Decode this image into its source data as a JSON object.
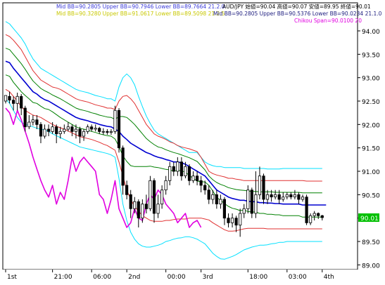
{
  "chart_data": {
    "type": "line",
    "title": "",
    "instrument_label": "AUD/JPY 始値=90.04 高値=90.07 安値=89.95 終値=90.01",
    "indicator_labels": [
      {
        "text": "Mid BB=90.2805 Upper BB=90.7946 Lower BB=89.7664  21.2.0",
        "color": "#3a3ad8"
      },
      {
        "text": "Mid BB=90.3280 Upper BB=91.0617 Lower BB=89.5098  21.2.5",
        "color": "#c8c800"
      },
      {
        "text": "Mid BB=90.2805 Upper BB=90.5376 Lower BB=90.0234  21.1.0",
        "color": "#202080"
      },
      {
        "text": "Chikou Span=90.0100  20",
        "color": "#e000e0"
      }
    ],
    "ylim": [
      88.9,
      94.6
    ],
    "y_ticks": [
      "94.00",
      "93.50",
      "93.00",
      "92.50",
      "92.00",
      "91.50",
      "91.00",
      "90.50",
      "90.00",
      "89.50",
      "89.00"
    ],
    "y_tick_values": [
      94.0,
      93.5,
      93.0,
      92.5,
      92.0,
      91.5,
      91.0,
      90.5,
      90.0,
      89.5,
      89.0
    ],
    "x_ticks": [
      "1st",
      "21:00",
      "06:00",
      "2nd",
      "00:00",
      "3rd",
      "18:00",
      "03:00",
      "4th"
    ],
    "x_tick_positions": [
      0,
      12,
      22,
      31,
      41,
      50,
      62,
      72,
      81
    ],
    "n_bars": 86,
    "last_price_label": "90.01",
    "colors": {
      "mid_bb": "#0000d0",
      "bb_2_0": "#e03030",
      "bb_2_5": "#00e0ff",
      "bb_1_0": "#008000",
      "chikou": "#e000e0",
      "price_box": "#00c000",
      "candle_up": "#ffffff",
      "candle_down": "#000000"
    },
    "series": [
      {
        "key": "mid",
        "values": [
          93.35,
          93.32,
          93.2,
          93.1,
          93.0,
          92.9,
          92.8,
          92.7,
          92.65,
          92.58,
          92.53,
          92.5,
          92.45,
          92.4,
          92.35,
          92.3,
          92.25,
          92.2,
          92.15,
          92.12,
          92.1,
          92.08,
          92.05,
          92.03,
          92.0,
          91.98,
          91.96,
          91.95,
          91.9,
          91.85,
          91.75,
          91.68,
          91.6,
          91.55,
          91.5,
          91.45,
          91.4,
          91.37,
          91.33,
          91.3,
          91.28,
          91.25,
          91.23,
          91.2,
          91.2,
          91.18,
          91.15,
          91.1,
          91.05,
          91.0,
          90.95,
          90.9,
          90.8,
          90.7,
          90.6,
          90.55,
          90.5,
          90.45,
          90.42,
          90.4,
          90.38,
          90.38,
          90.36,
          90.35,
          90.35,
          90.33,
          90.33,
          90.32,
          90.32,
          90.31,
          90.31,
          90.3,
          90.3,
          90.3,
          90.3,
          90.3,
          90.28,
          90.28,
          90.28,
          90.28,
          90.28,
          90.28,
          90.28
        ]
      },
      {
        "key": "upper20",
        "values": [
          93.92,
          93.88,
          93.8,
          93.7,
          93.6,
          93.45,
          93.3,
          93.15,
          93.05,
          92.95,
          92.9,
          92.85,
          92.8,
          92.78,
          92.75,
          92.7,
          92.65,
          92.6,
          92.55,
          92.52,
          92.5,
          92.48,
          92.45,
          92.42,
          92.4,
          92.38,
          92.35,
          92.35,
          92.32,
          92.5,
          92.6,
          92.62,
          92.55,
          92.45,
          92.3,
          92.15,
          92.0,
          91.9,
          91.8,
          91.75,
          91.72,
          91.68,
          91.63,
          91.6,
          91.55,
          91.52,
          91.5,
          91.48,
          91.45,
          91.42,
          91.3,
          91.15,
          91.0,
          90.95,
          90.92,
          90.9,
          90.88,
          90.85,
          90.85,
          90.83,
          90.82,
          90.8,
          90.8,
          90.8,
          90.8,
          90.8,
          90.8,
          90.8,
          90.8,
          90.8,
          90.8,
          90.8,
          90.8,
          90.8,
          90.8,
          90.8,
          90.8,
          90.79,
          90.79,
          90.79,
          90.79,
          90.79
        ]
      },
      {
        "key": "lower20",
        "values": [
          92.75,
          92.7,
          92.6,
          92.5,
          92.38,
          92.3,
          92.25,
          92.2,
          92.18,
          92.15,
          92.1,
          92.05,
          92.0,
          91.96,
          91.93,
          91.9,
          91.86,
          91.82,
          91.78,
          91.74,
          91.72,
          91.7,
          91.68,
          91.65,
          91.62,
          91.58,
          91.55,
          91.5,
          91.45,
          91.2,
          90.9,
          90.6,
          90.4,
          90.25,
          90.15,
          90.05,
          90.0,
          89.95,
          89.93,
          89.93,
          89.93,
          89.95,
          89.95,
          89.97,
          89.98,
          89.98,
          89.98,
          90.0,
          90.0,
          90.0,
          90.0,
          89.98,
          89.96,
          89.9,
          89.85,
          89.8,
          89.75,
          89.72,
          89.72,
          89.73,
          89.75,
          89.77,
          89.78,
          89.78,
          89.78,
          89.78,
          89.78,
          89.77,
          89.77,
          89.77,
          89.77,
          89.77,
          89.77,
          89.77,
          89.77,
          89.77,
          89.77,
          89.77,
          89.77,
          89.77,
          89.77,
          89.77
        ]
      },
      {
        "key": "upper25",
        "values": [
          94.2,
          94.15,
          94.05,
          93.95,
          93.85,
          93.72,
          93.55,
          93.4,
          93.3,
          93.2,
          93.15,
          93.1,
          93.05,
          93.0,
          92.95,
          92.9,
          92.85,
          92.8,
          92.75,
          92.72,
          92.7,
          92.68,
          92.65,
          92.62,
          92.6,
          92.58,
          92.55,
          92.55,
          92.5,
          92.8,
          93.0,
          93.08,
          93.0,
          92.85,
          92.6,
          92.38,
          92.18,
          92.02,
          91.88,
          91.8,
          91.75,
          91.7,
          91.65,
          91.6,
          91.55,
          91.5,
          91.45,
          91.4,
          91.4,
          91.4,
          91.3,
          91.2,
          91.15,
          91.12,
          91.1,
          91.1,
          91.08,
          91.08,
          91.08,
          91.08,
          91.08,
          91.06,
          91.06,
          91.06,
          91.06,
          91.06,
          91.06,
          91.05,
          91.05,
          91.05,
          91.05,
          91.06,
          91.06,
          91.06,
          91.06,
          91.06,
          91.06,
          91.06,
          91.06,
          91.06,
          91.06,
          91.06
        ]
      },
      {
        "key": "lower25",
        "values": [
          92.55,
          92.45,
          92.3,
          92.15,
          92.05,
          92.0,
          91.98,
          91.95,
          91.92,
          91.9,
          91.88,
          91.85,
          91.8,
          91.76,
          91.72,
          91.68,
          91.64,
          91.6,
          91.56,
          91.52,
          91.5,
          91.48,
          91.46,
          91.44,
          91.42,
          91.4,
          91.38,
          91.35,
          91.3,
          90.85,
          90.3,
          89.95,
          89.7,
          89.55,
          89.45,
          89.4,
          89.38,
          89.38,
          89.4,
          89.42,
          89.45,
          89.5,
          89.52,
          89.55,
          89.57,
          89.58,
          89.6,
          89.6,
          89.58,
          89.55,
          89.5,
          89.45,
          89.35,
          89.25,
          89.18,
          89.13,
          89.12,
          89.15,
          89.18,
          89.22,
          89.27,
          89.32,
          89.35,
          89.38,
          89.4,
          89.42,
          89.42,
          89.43,
          89.45,
          89.46,
          89.48,
          89.48,
          89.5,
          89.5,
          89.5,
          89.5,
          89.5,
          89.5,
          89.5,
          89.5,
          89.5,
          89.5
        ]
      },
      {
        "key": "upper10",
        "values": [
          93.63,
          93.6,
          93.5,
          93.4,
          93.3,
          93.18,
          93.05,
          92.93,
          92.85,
          92.77,
          92.72,
          92.68,
          92.63,
          92.59,
          92.55,
          92.5,
          92.45,
          92.4,
          92.35,
          92.32,
          92.3,
          92.28,
          92.25,
          92.23,
          92.2,
          92.18,
          92.16,
          92.15,
          92.11,
          92.17,
          92.17,
          92.15,
          92.08,
          92.0,
          91.9,
          91.8,
          91.7,
          91.63,
          91.57,
          91.52,
          91.5,
          91.46,
          91.43,
          91.4,
          91.38,
          91.35,
          91.32,
          91.29,
          91.25,
          91.21,
          91.12,
          91.03,
          90.9,
          90.82,
          90.76,
          90.72,
          90.69,
          90.65,
          90.63,
          90.61,
          90.6,
          90.59,
          90.58,
          90.57,
          90.57,
          90.56,
          90.56,
          90.56,
          90.56,
          90.55,
          90.55,
          90.55,
          90.55,
          90.55,
          90.55,
          90.55,
          90.54,
          90.54,
          90.54,
          90.54,
          90.54,
          90.54
        ]
      },
      {
        "key": "lower10",
        "values": [
          93.06,
          93.03,
          92.9,
          92.8,
          92.7,
          92.62,
          92.55,
          92.47,
          92.45,
          92.39,
          92.34,
          92.32,
          92.27,
          92.21,
          92.15,
          92.1,
          92.05,
          92.0,
          91.95,
          91.92,
          91.9,
          91.88,
          91.85,
          91.83,
          91.8,
          91.78,
          91.76,
          91.75,
          91.69,
          91.53,
          91.33,
          91.21,
          91.12,
          91.1,
          91.1,
          91.1,
          91.1,
          91.11,
          91.09,
          91.08,
          91.06,
          91.04,
          91.03,
          91.0,
          91.02,
          91.01,
          90.98,
          90.91,
          90.85,
          90.79,
          90.78,
          90.77,
          90.7,
          90.58,
          90.44,
          90.38,
          90.31,
          90.25,
          90.21,
          90.19,
          90.16,
          90.17,
          90.14,
          90.13,
          90.13,
          90.1,
          90.1,
          90.08,
          90.08,
          90.07,
          90.07,
          90.05,
          90.05,
          90.05,
          90.05,
          90.05,
          90.02,
          90.02,
          90.02,
          90.02,
          90.02,
          90.02
        ]
      },
      {
        "key": "chikou",
        "values": [
          92.35,
          92.25,
          92.0,
          92.3,
          92.1,
          91.85,
          91.6,
          91.3,
          91.05,
          90.8,
          90.6,
          90.45,
          90.7,
          90.3,
          90.55,
          90.4,
          90.8,
          91.3,
          91.0,
          91.2,
          91.3,
          91.2,
          91.1,
          91.0,
          90.5,
          90.4,
          90.1,
          90.4,
          90.8,
          90.2,
          90.0,
          89.8,
          89.9,
          90.2,
          90.0,
          89.95,
          90.3,
          90.5,
          90.4,
          90.6,
          90.5,
          90.3,
          90.2,
          90.1,
          89.9,
          90.0,
          90.1,
          89.8,
          89.9,
          89.95,
          89.8
        ]
      }
    ],
    "candles": [
      [
        92.5,
        92.62,
        92.62,
        92.45
      ],
      [
        92.6,
        92.52,
        92.7,
        92.45
      ],
      [
        92.52,
        92.45,
        92.6,
        92.3
      ],
      [
        92.45,
        92.6,
        92.68,
        92.3
      ],
      [
        92.6,
        92.35,
        92.65,
        92.2
      ],
      [
        92.35,
        91.95,
        92.4,
        91.85
      ],
      [
        91.95,
        92.05,
        92.2,
        91.9
      ],
      [
        92.05,
        92.1,
        92.2,
        91.98
      ],
      [
        92.1,
        92.0,
        92.2,
        91.9
      ],
      [
        92.0,
        91.75,
        92.05,
        91.6
      ],
      [
        91.75,
        91.9,
        92.0,
        91.7
      ],
      [
        91.9,
        91.85,
        92.0,
        91.75
      ],
      [
        91.85,
        91.95,
        92.05,
        91.8
      ],
      [
        91.95,
        91.8,
        92.0,
        91.6
      ],
      [
        91.8,
        91.85,
        91.95,
        91.7
      ],
      [
        91.85,
        91.9,
        92.0,
        91.8
      ],
      [
        91.9,
        91.95,
        92.05,
        91.85
      ],
      [
        91.95,
        91.85,
        92.0,
        91.75
      ],
      [
        91.85,
        91.9,
        92.0,
        91.7
      ],
      [
        91.9,
        91.75,
        91.95,
        91.6
      ],
      [
        91.75,
        91.85,
        91.9,
        91.65
      ],
      [
        91.85,
        91.95,
        92.0,
        91.8
      ],
      [
        91.95,
        91.9,
        92.0,
        91.85
      ],
      [
        91.9,
        91.92,
        92.0,
        91.85
      ],
      [
        91.92,
        91.85,
        91.95,
        91.8
      ],
      [
        91.85,
        91.85,
        91.92,
        91.78
      ],
      [
        91.85,
        91.83,
        91.9,
        91.78
      ],
      [
        91.83,
        91.85,
        91.9,
        91.78
      ],
      [
        91.85,
        92.3,
        92.4,
        91.8
      ],
      [
        92.3,
        91.5,
        92.35,
        91.4
      ],
      [
        91.5,
        90.7,
        91.55,
        90.5
      ],
      [
        90.7,
        90.5,
        90.8,
        90.4
      ],
      [
        90.5,
        90.2,
        90.6,
        90.0
      ],
      [
        90.2,
        90.35,
        90.45,
        90.1
      ],
      [
        90.35,
        90.0,
        90.4,
        89.8
      ],
      [
        90.0,
        90.3,
        90.4,
        89.9
      ],
      [
        90.3,
        90.2,
        90.5,
        90.1
      ],
      [
        90.2,
        90.8,
        90.9,
        90.15
      ],
      [
        90.8,
        90.1,
        90.85,
        89.9
      ],
      [
        90.1,
        90.3,
        90.5,
        90.0
      ],
      [
        90.3,
        90.6,
        90.7,
        90.2
      ],
      [
        90.6,
        90.8,
        90.9,
        90.5
      ],
      [
        90.8,
        91.1,
        91.2,
        90.7
      ],
      [
        91.1,
        91.0,
        91.2,
        90.9
      ],
      [
        91.0,
        91.2,
        91.3,
        90.9
      ],
      [
        91.2,
        90.9,
        91.3,
        90.8
      ],
      [
        90.9,
        91.1,
        91.2,
        90.85
      ],
      [
        91.1,
        90.8,
        91.15,
        90.7
      ],
      [
        90.8,
        90.9,
        91.0,
        90.75
      ],
      [
        90.9,
        90.8,
        91.0,
        90.7
      ],
      [
        90.8,
        90.7,
        90.9,
        90.55
      ],
      [
        90.7,
        90.6,
        90.8,
        90.5
      ],
      [
        90.6,
        90.4,
        90.7,
        90.3
      ],
      [
        90.4,
        90.5,
        90.6,
        90.3
      ],
      [
        90.5,
        90.3,
        90.6,
        90.2
      ],
      [
        90.3,
        90.4,
        90.5,
        90.2
      ],
      [
        90.4,
        90.0,
        90.45,
        89.85
      ],
      [
        90.0,
        89.9,
        90.1,
        89.8
      ],
      [
        89.9,
        90.0,
        90.1,
        89.8
      ],
      [
        90.0,
        89.85,
        90.05,
        89.7
      ],
      [
        89.85,
        90.1,
        90.2,
        89.6
      ],
      [
        90.1,
        90.2,
        90.3,
        90.0
      ],
      [
        90.2,
        90.6,
        90.7,
        90.1
      ],
      [
        90.6,
        90.1,
        90.65,
        90.0
      ],
      [
        90.1,
        90.5,
        91.0,
        90.0
      ],
      [
        90.5,
        90.9,
        91.1,
        90.4
      ],
      [
        90.9,
        90.4,
        90.95,
        90.3
      ],
      [
        90.4,
        90.5,
        90.6,
        90.3
      ],
      [
        90.5,
        90.45,
        90.6,
        90.35
      ],
      [
        90.45,
        90.5,
        90.6,
        90.4
      ],
      [
        90.5,
        90.4,
        90.6,
        90.3
      ],
      [
        90.4,
        90.45,
        90.55,
        90.35
      ],
      [
        90.45,
        90.5,
        90.55,
        90.4
      ],
      [
        90.5,
        90.45,
        90.55,
        90.4
      ],
      [
        90.45,
        90.5,
        90.6,
        90.4
      ],
      [
        90.5,
        90.4,
        90.55,
        90.3
      ],
      [
        90.4,
        90.45,
        90.5,
        90.35
      ],
      [
        90.45,
        89.9,
        90.5,
        89.85
      ],
      [
        89.9,
        90.05,
        90.1,
        89.85
      ],
      [
        90.05,
        90.1,
        90.15,
        89.95
      ],
      [
        90.1,
        90.05,
        90.12,
        89.98
      ],
      [
        90.05,
        90.01,
        90.07,
        89.95
      ]
    ]
  }
}
